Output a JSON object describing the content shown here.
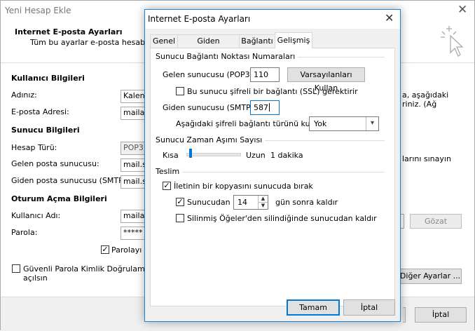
{
  "background": {
    "title": "Yeni Hesap Ekle",
    "header_title": "Internet E-posta Ayarları",
    "header_subtitle": "Tüm bu ayarlar e-posta hesabınız",
    "user_info_title": "Kullanıcı Bilgileri",
    "name_label": "Adınız:",
    "name_value": "Kalene",
    "email_label": "E-posta Adresi:",
    "email_value": "mailad",
    "server_info_title": "Sunucu Bilgileri",
    "account_type_label": "Hesap Türü:",
    "account_type_value": "POP3",
    "incoming_label": "Gelen posta sunucusu:",
    "incoming_value": "mail.sit",
    "outgoing_label": "Giden posta sunucusu (SMTP):",
    "outgoing_value": "mail.sit",
    "logon_info_title": "Oturum Açma Bilgileri",
    "username_label": "Kullanıcı Adı:",
    "username_value": "mailad",
    "password_label": "Parola:",
    "password_value": "*****",
    "remember_password_label": "Parolayı a",
    "spa_label_line1": "Güvenli Parola Kimlik Doğrulaması (SF",
    "spa_label_line2": "açılsın",
    "right_text_line1": "a, aşağıdaki",
    "right_text_line2": "riniz. (Ağ",
    "right_text_test": "larını sınayın",
    "browse_button": "Gözat",
    "more_settings_button": "Diğer Ayarlar ...",
    "cancel_button": "İptal"
  },
  "dialog": {
    "title": "Internet E-posta Ayarları",
    "tabs": [
      "Genel",
      "Giden Sunucusu",
      "Bağlantı",
      "Gelişmiş"
    ],
    "active_tab": "Gelişmiş",
    "ports_group": "Sunucu Bağlantı Noktası Numaraları",
    "incoming_label": "Gelen sunucusu (POP3):",
    "incoming_port": "110",
    "defaults_button": "Varsayılanları Kullan",
    "ssl_label": "Bu sunucu şifreli bir bağlantı (SSL) gerektirir",
    "ssl_checked": false,
    "outgoing_label": "Giden sunucusu (SMTP):",
    "outgoing_port": "587",
    "encryption_label": "Aşağıdaki şifreli bağlantı türünü kullan:",
    "encryption_value": "Yok",
    "timeout_group": "Sunucu Zaman Aşımı Sayısı",
    "timeout_short": "Kısa",
    "timeout_long": "Uzun",
    "timeout_value": "1 dakika",
    "timeout_level": 0.05,
    "delivery_group": "Teslim",
    "leave_copy_label": "İletinin bir kopyasını sunucuda bırak",
    "leave_copy_checked": true,
    "remove_after_label": "Sunucudan",
    "remove_after_checked": true,
    "remove_days": "14",
    "remove_days_suffix": "gün sonra kaldır",
    "remove_deleted_label": "Silinmiş Öğeler'den silindiğinde sunucudan kaldır",
    "remove_deleted_checked": false,
    "ok_button": "Tamam",
    "cancel_button": "İptal"
  },
  "icons": {
    "close": "close-icon",
    "wizard_cursor": "cursor-sparkle-icon",
    "dropdown": "chevron-down-icon",
    "spin_up": "spin-up-icon",
    "spin_down": "spin-down-icon",
    "check": "checkmark-icon"
  },
  "colors": {
    "accent": "#0078d7",
    "dialog_border": "#1883d7"
  }
}
